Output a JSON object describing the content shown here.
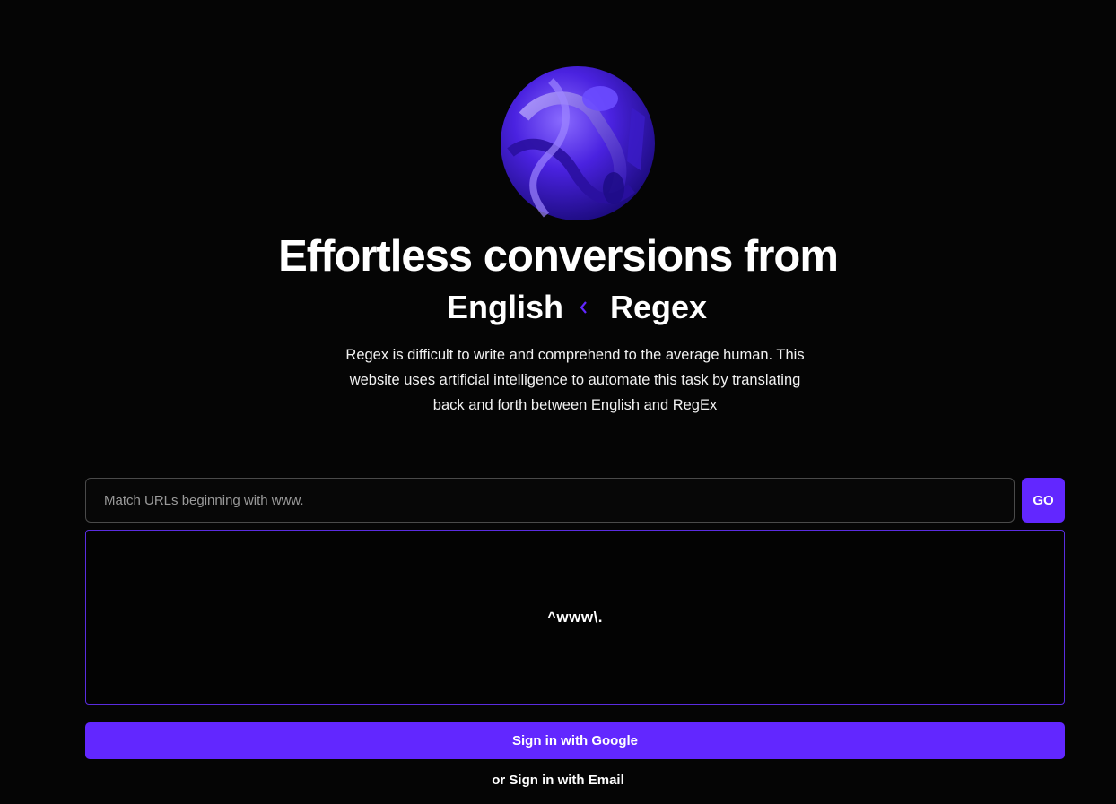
{
  "hero": {
    "headline": "Effortless conversions from",
    "left_word": "English",
    "right_word": "Regex",
    "swap_icon": "swap-arrows-icon",
    "description": "Regex is difficult to write and comprehend to the average human. This website uses artificial intelligence to automate this task by translating back and forth between English and RegEx"
  },
  "query": {
    "placeholder": "Match URLs beginning with www.",
    "value": "",
    "go_label": "GO"
  },
  "output": {
    "text": "^www\\."
  },
  "auth": {
    "google_label": "Sign in with Google",
    "email_label": "or Sign in with Email"
  },
  "colors": {
    "background": "#050505",
    "accent": "#6227ff",
    "output_border": "#5a2ce0"
  }
}
